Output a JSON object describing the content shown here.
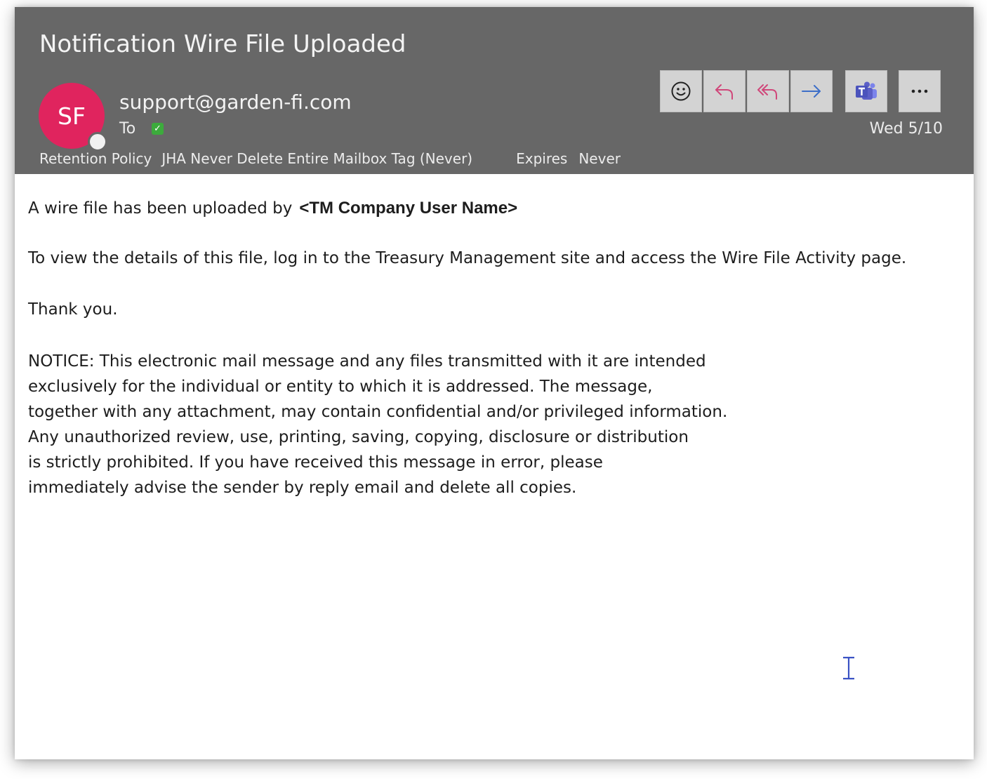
{
  "email": {
    "subject": "Notification Wire File Uploaded",
    "avatar_initials": "SF",
    "avatar_color": "#e0245e",
    "sender": "support@garden-fi.com",
    "to_label": "To",
    "date": "Wed 5/10",
    "retention_policy_label": "Retention Policy",
    "retention_policy_value": "JHA Never Delete Entire Mailbox Tag (Never)",
    "expires_label": "Expires",
    "expires_value": "Never"
  },
  "toolbar": {
    "buttons": [
      {
        "name": "emoji-react",
        "icon": "smiley-icon"
      },
      {
        "name": "reply",
        "icon": "reply-icon",
        "color": "#d0477a"
      },
      {
        "name": "reply-all",
        "icon": "reply-all-icon",
        "color": "#d0477a"
      },
      {
        "name": "forward",
        "icon": "forward-icon",
        "color": "#3d6fc8"
      },
      {
        "name": "teams",
        "icon": "teams-icon",
        "color": "#5b5fc7"
      },
      {
        "name": "more",
        "icon": "more-icon"
      }
    ]
  },
  "body": {
    "line1_prefix": "A wire file has been uploaded by",
    "line1_user": "<TM Company User Name>",
    "line2": "To view the details of this file, log in to the Treasury Management site and access the Wire File Activity page.",
    "thanks": "Thank you.",
    "notice_lines": [
      "NOTICE: This electronic mail message and any files transmitted with it are intended",
      "exclusively for the individual or entity to which it is addressed. The message,",
      "together with any attachment, may contain confidential and/or privileged information.",
      "Any unauthorized review, use, printing, saving, copying, disclosure or distribution",
      "is strictly prohibited. If you have received this message in error, please",
      "immediately advise the sender by reply email and delete all copies."
    ]
  }
}
